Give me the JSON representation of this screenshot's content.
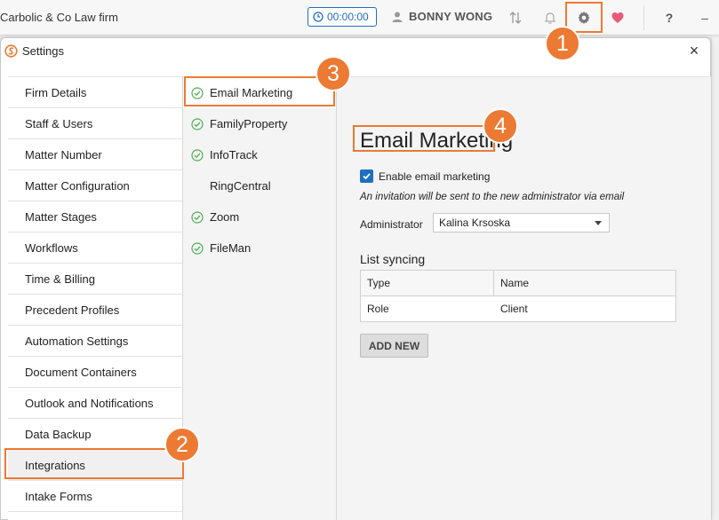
{
  "appbar": {
    "firm_name": "Carbolic & Co Law firm",
    "timer": "00:00:00",
    "user_name": "BONNY WONG",
    "help": "?",
    "minimize": "–"
  },
  "dialog": {
    "title": "Settings",
    "close": "×"
  },
  "nav": {
    "items": [
      {
        "label": "Firm Details"
      },
      {
        "label": "Staff & Users"
      },
      {
        "label": "Matter Number"
      },
      {
        "label": "Matter Configuration"
      },
      {
        "label": "Matter Stages"
      },
      {
        "label": "Workflows"
      },
      {
        "label": "Time & Billing"
      },
      {
        "label": "Precedent Profiles"
      },
      {
        "label": "Automation Settings"
      },
      {
        "label": "Document Containers"
      },
      {
        "label": "Outlook and Notifications"
      },
      {
        "label": "Data Backup"
      },
      {
        "label": "Integrations"
      },
      {
        "label": "Intake Forms"
      }
    ],
    "active": "Integrations"
  },
  "integrations": {
    "items": [
      {
        "label": "Email Marketing",
        "enabled": true
      },
      {
        "label": "FamilyProperty",
        "enabled": true
      },
      {
        "label": "InfoTrack",
        "enabled": true
      },
      {
        "label": "RingCentral",
        "enabled": false
      },
      {
        "label": "Zoom",
        "enabled": true
      },
      {
        "label": "FileMan",
        "enabled": true
      }
    ],
    "active": "Email Marketing"
  },
  "content": {
    "title": "Email Marketing",
    "enable_label": "Enable email marketing",
    "enable_checked": true,
    "invite_note": "An invitation will be sent to the new administrator via email",
    "admin_label": "Administrator",
    "admin_value": "Kalina Krsoska",
    "list_syncing": {
      "title": "List syncing",
      "columns": [
        "Type",
        "Name"
      ],
      "rows": [
        [
          "Role",
          "Client"
        ]
      ]
    },
    "add_new": "ADD NEW"
  },
  "callouts": [
    "1",
    "2",
    "3",
    "4"
  ],
  "colors": {
    "accent": "#ec7a33",
    "primary": "#1f6fbf",
    "check_green": "#4caf50",
    "heart": "#e85a7a"
  },
  "icons": [
    "clock-icon",
    "user-icon",
    "sort-icon",
    "bell-icon",
    "gear-icon",
    "heart-icon",
    "app-logo-icon",
    "check-circle-icon"
  ]
}
